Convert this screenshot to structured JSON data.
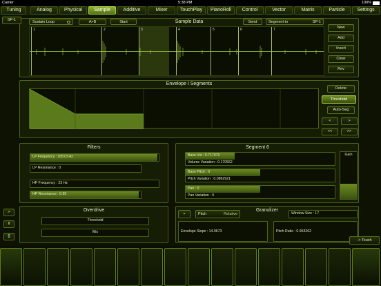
{
  "status": {
    "carrier": "Carrier",
    "time": "5:38 PM",
    "battery": "100%"
  },
  "tabs": [
    "Tuning",
    "Analog",
    "Physical",
    "Sample",
    "Additive",
    "Mixer",
    "TouchPlay",
    "PianoRoll",
    "Control",
    "Vector",
    "Matrix",
    "Particle",
    "Settings"
  ],
  "active_tab": "Sample",
  "sample": {
    "preset": "SP-1",
    "loop_mode": "Sustain Loop",
    "direction": "A>B",
    "start_label": "Start",
    "title": "Sample Data",
    "send_label": "Send",
    "segment_to_label": "Segment to",
    "segment_to_value": "SP-1",
    "markers": [
      "1",
      "2",
      "3",
      "4",
      "5",
      "6",
      "7"
    ],
    "buttons": [
      "New",
      "Add",
      "Insert",
      "Clear",
      "Rev"
    ]
  },
  "envelope": {
    "title": "Envelope I Segments",
    "buttons": {
      "delete": "Delete",
      "threshold": "Threshold",
      "auto_seg": "Auto-Seg",
      "left": "<",
      "right": ">",
      "far_left": "<<",
      "far_right": ">>"
    },
    "curve": [
      1.0,
      0.38,
      0.38,
      0.0
    ]
  },
  "filters": {
    "title": "Filters",
    "lp_frequency": {
      "label": "LP Frequency : 20573 Hz",
      "level": 0.99
    },
    "lp_resonance": {
      "label": "LP Resonance : 0",
      "level": 0.0
    },
    "hp_frequency": {
      "label": "HP Frequency : 23 Hz",
      "level": 0.0
    },
    "hp_resonance": {
      "label": "HP Resonance : 0.95",
      "level": 0.98
    }
  },
  "segment": {
    "title": "Segment 6",
    "base_vol": {
      "label": "Base Vol : 0.717079",
      "level": 0.33
    },
    "volume_variation": {
      "label": "Volume Variation : 0.170552",
      "level": 0.0
    },
    "base_pitch": {
      "label": "Base Pitch : 0",
      "level": 0.5
    },
    "pitch_variation": {
      "label": "Pitch Variation : 0.0862921",
      "level": 0.0
    },
    "pan": {
      "label": "Pan : 0",
      "level": 0.5
    },
    "pan_variation": {
      "label": "Pan Variation : 0",
      "level": 0.0
    },
    "gain_label": "Gain",
    "gain_level": 0.33
  },
  "overdrive": {
    "title": "Overdrive",
    "threshold": {
      "label": "Threshold",
      "level": 0.0
    },
    "mix": {
      "label": "Mix",
      "level": 0.0
    }
  },
  "granulizer": {
    "title": "Granulizer",
    "plus_label": "+",
    "pitch_label": "Pitch",
    "relative_label": "Relative",
    "window_size": {
      "label": "Window Size : 17",
      "level": 0.0
    },
    "envelope_slope": {
      "label": "Envelope Slope : 14.9673",
      "level": 0.0
    },
    "pitch_ratio": {
      "label": "Pitch Ratio : 0.953262",
      "level": 0.0
    }
  },
  "side_buttons": [
    ">",
    "II",
    "[]"
  ],
  "touch_label": "-> Touch"
}
